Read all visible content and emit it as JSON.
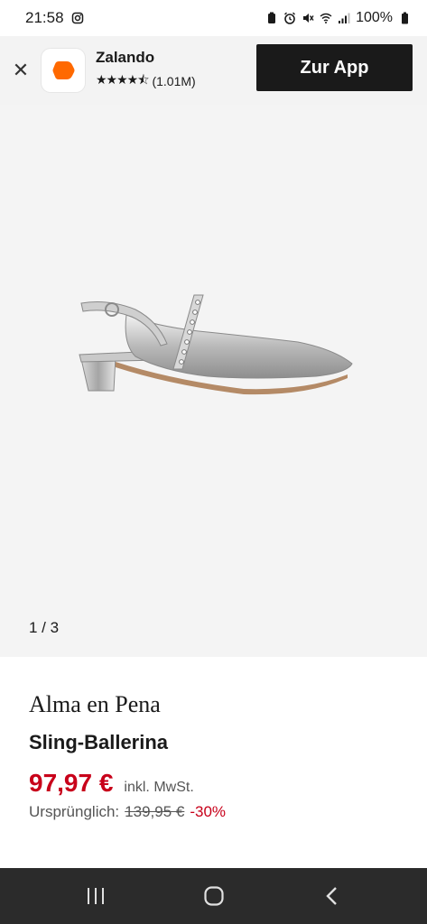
{
  "status_bar": {
    "time": "21:58",
    "battery": "100%"
  },
  "app_banner": {
    "app_name": "Zalando",
    "stars": "★★★★⯪",
    "rating_count": "(1.01M)",
    "cta_label": "Zur App",
    "brand_color": "#ff6900"
  },
  "gallery": {
    "counter": "1 / 3",
    "image_description": "silver-sling-ballerina-shoe"
  },
  "product": {
    "brand": "Alma en Pena",
    "name": "Sling-Ballerina",
    "price": "97,97 €",
    "vat_note": "inkl. MwSt.",
    "original_label": "Ursprünglich:",
    "original_price": "139,95 €",
    "discount": "-30%",
    "price_color": "#c8001a"
  },
  "nav_bar": {
    "recent_icon": "recent-apps-icon",
    "home_icon": "home-icon",
    "back_icon": "back-icon"
  }
}
